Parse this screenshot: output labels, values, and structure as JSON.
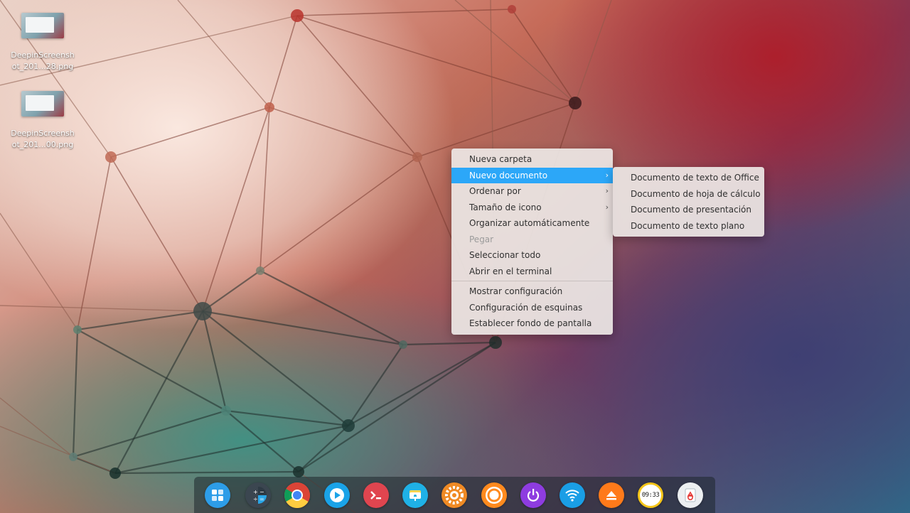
{
  "desktop": {
    "icons": [
      {
        "label": "DeepinScreenshot_201...28.png"
      },
      {
        "label": "DeepinScreenshot_201...00.png"
      }
    ]
  },
  "context_menu": {
    "items": [
      {
        "label": "Nueva carpeta"
      },
      {
        "label": "Nuevo documento",
        "submenu": true,
        "highlighted": true
      },
      {
        "label": "Ordenar por",
        "submenu": true
      },
      {
        "label": "Tamaño de icono",
        "submenu": true
      },
      {
        "label": "Organizar automáticamente"
      },
      {
        "label": "Pegar",
        "disabled": true
      },
      {
        "label": "Seleccionar todo"
      },
      {
        "label": "Abrir en el terminal"
      },
      {
        "label": "Mostrar configuración"
      },
      {
        "label": "Configuración de esquinas"
      },
      {
        "label": "Establecer fondo de pantalla"
      }
    ],
    "submenu_arrow": "›"
  },
  "submenu": {
    "items": [
      {
        "label": "Documento de texto de Office"
      },
      {
        "label": "Documento de hoja de cálculo"
      },
      {
        "label": "Documento de presentación"
      },
      {
        "label": "Documento de texto plano"
      }
    ]
  },
  "dock": {
    "apps": [
      {
        "icon": "launcher-icon",
        "color": "#2d9de8"
      },
      {
        "icon": "calculator-icon",
        "color": "#3b4650"
      },
      {
        "icon": "chrome-icon",
        "color": "#dd4b39"
      },
      {
        "icon": "media-player-icon",
        "color": "#1aa3e8"
      },
      {
        "icon": "terminal-icon",
        "color": "#e0454f"
      },
      {
        "icon": "file-manager-icon",
        "color": "#1fb1e6"
      },
      {
        "icon": "settings-icon",
        "color": "#f08a24"
      },
      {
        "icon": "support-icon",
        "color": "#ff8a1e"
      },
      {
        "icon": "power-icon",
        "color": "#8e3ce0"
      },
      {
        "icon": "wifi-icon",
        "color": "#1a9ee6"
      },
      {
        "icon": "eject-icon",
        "color": "#ff7a1a"
      },
      {
        "icon": "clock-icon",
        "color": "#f5c518",
        "time": "09:33"
      },
      {
        "icon": "trash-icon",
        "color": "#eceff1"
      }
    ]
  }
}
